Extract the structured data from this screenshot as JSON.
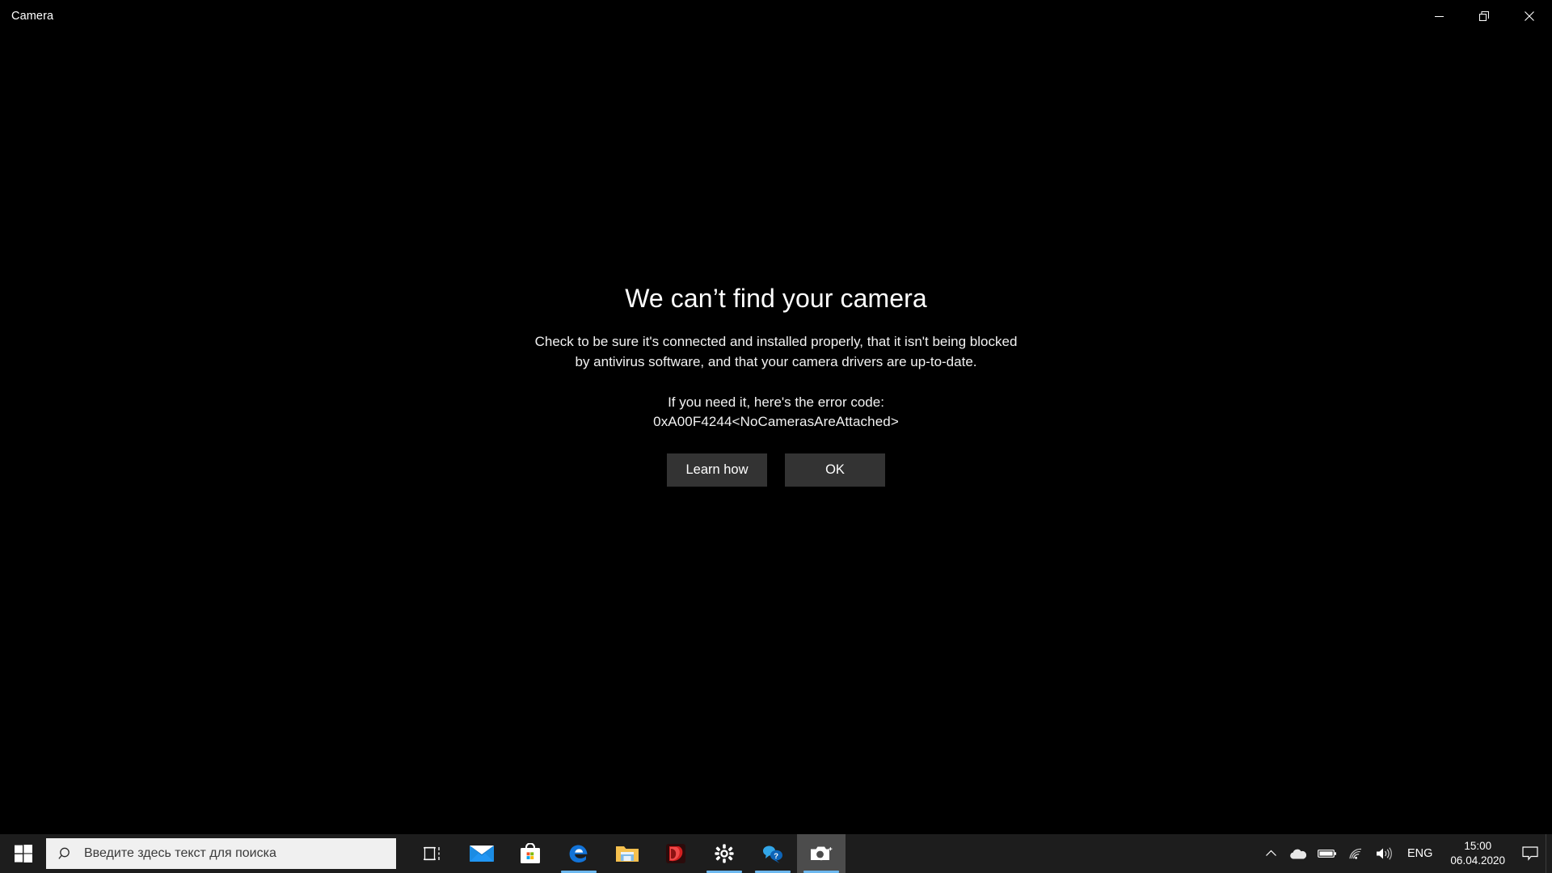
{
  "window": {
    "title": "Camera",
    "controls": [
      {
        "name": "minimize-button",
        "icon": "minimize-icon",
        "label": "Minimize"
      },
      {
        "name": "maximize-restore-button",
        "icon": "restore-icon",
        "label": "Restore Down"
      },
      {
        "name": "close-button",
        "icon": "close-icon",
        "label": "Close"
      }
    ]
  },
  "dialog": {
    "heading": "We can’t find your camera",
    "body_line1": "Check to be sure it's connected and installed properly, that it isn't being blocked",
    "body_line2": "by antivirus software, and that your camera drivers are up-to-date.",
    "error_intro": "If you need it, here's the error code:",
    "error_code": "0xA00F4244<NoCamerasAreAttached>",
    "buttons": {
      "learn_how": "Learn how",
      "ok": "OK"
    },
    "button_bg": "#333333",
    "text_color": "#ffffff"
  },
  "taskbar": {
    "background": "#1d1d1d",
    "start": {
      "label": "Start",
      "icon": "windows-logo-icon"
    },
    "search": {
      "placeholder": "Введите здесь текст для поиска",
      "value": "",
      "icon": "search-icon",
      "background": "#f0f0f0"
    },
    "items": [
      {
        "name": "task-view-button",
        "label": "Task View",
        "icon": "task-view-icon",
        "running": false,
        "active": false
      },
      {
        "name": "taskbar-item-mail",
        "label": "Mail",
        "icon": "mail-icon",
        "running": false,
        "active": false
      },
      {
        "name": "taskbar-item-store",
        "label": "Microsoft Store",
        "icon": "store-icon",
        "running": false,
        "active": false
      },
      {
        "name": "taskbar-item-edge",
        "label": "Microsoft Edge",
        "icon": "edge-icon",
        "running": true,
        "active": false
      },
      {
        "name": "taskbar-item-file-explorer",
        "label": "File Explorer",
        "icon": "folder-icon",
        "running": false,
        "active": false
      },
      {
        "name": "taskbar-item-media-player",
        "label": "Media Player",
        "icon": "media-player-icon",
        "running": false,
        "active": false
      },
      {
        "name": "taskbar-item-settings",
        "label": "Settings",
        "icon": "gear-icon",
        "running": true,
        "active": false
      },
      {
        "name": "taskbar-item-get-help",
        "label": "Get Help",
        "icon": "get-help-icon",
        "running": true,
        "active": false
      },
      {
        "name": "taskbar-item-camera",
        "label": "Camera",
        "icon": "camera-icon",
        "running": true,
        "active": true
      }
    ],
    "tray": {
      "items": [
        {
          "name": "tray-show-hidden-icons",
          "label": "Show hidden icons",
          "icon": "chevron-up-icon"
        },
        {
          "name": "tray-onedrive",
          "label": "OneDrive",
          "icon": "cloud-icon"
        },
        {
          "name": "tray-battery",
          "label": "Battery",
          "icon": "battery-icon"
        },
        {
          "name": "tray-network",
          "label": "Network",
          "icon": "wifi-icon"
        },
        {
          "name": "tray-volume",
          "label": "Volume",
          "icon": "speaker-icon"
        }
      ],
      "language": "ENG",
      "time": "15:00",
      "date": "06.04.2020",
      "action_center": {
        "label": "Notifications",
        "icon": "notification-bubble-icon"
      },
      "show_desktop": {
        "label": "Show desktop"
      }
    }
  }
}
